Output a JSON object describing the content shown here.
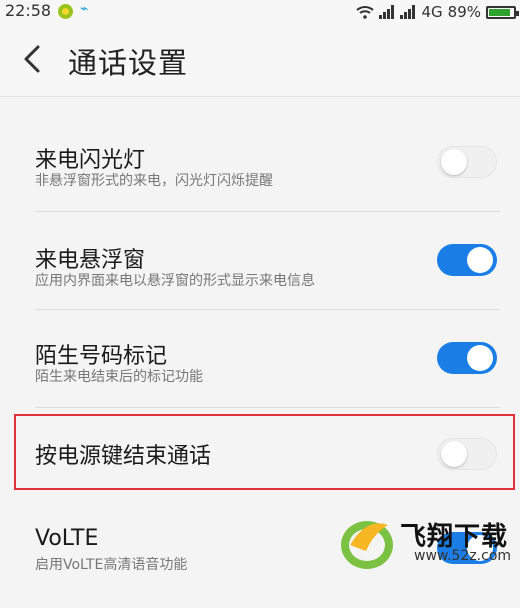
{
  "status_bar": {
    "time": "22:58",
    "network": "4G",
    "battery": "89%",
    "battery_level": 0.89
  },
  "header": {
    "title": "通话设置",
    "back_icon": "chevron-left-icon"
  },
  "settings": [
    {
      "title": "来电闪光灯",
      "subtitle": "非悬浮窗形式的来电，闪光灯闪烁提醒",
      "enabled": false
    },
    {
      "title": "来电悬浮窗",
      "subtitle": "应用内界面来电以悬浮窗的形式显示来电信息",
      "enabled": true
    },
    {
      "title": "陌生号码标记",
      "subtitle": "陌生来电结束后的标记功能",
      "enabled": true
    },
    {
      "title": "按电源键结束通话",
      "subtitle": "",
      "enabled": false
    },
    {
      "title": "VoLTE",
      "subtitle": "启用VoLTE高清语音功能",
      "enabled": true
    }
  ],
  "watermark": {
    "text": "飞翔下载",
    "url": "www.52z.com"
  },
  "colors": {
    "toggle_on": "#1a7ee6",
    "highlight": "#e0303a"
  }
}
